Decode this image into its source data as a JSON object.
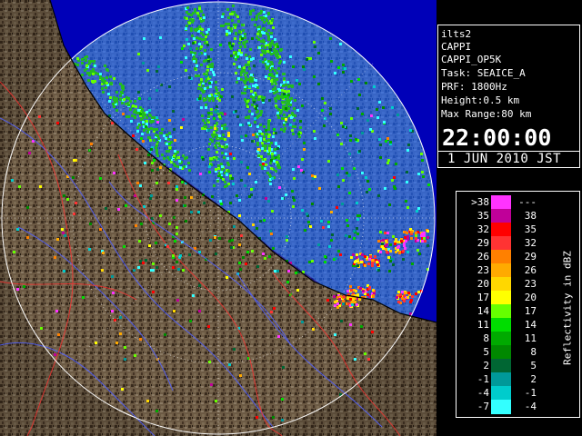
{
  "info": {
    "radar": "ilts2",
    "product": "CAPPI",
    "product_id": "CAPPI_OP5K",
    "task": "Task: SEAICE_A",
    "prf": "PRF: 1800Hz",
    "height": "Height:0.5 km",
    "max_range": "Max Range:80 km",
    "time": "22:00:00",
    "date": "1 JUN 2010 JST"
  },
  "legend": {
    "unit_label": "Reflectivity in dBZ",
    "rows": [
      {
        "low": ">38",
        "high": "---",
        "color": "#ff33ff"
      },
      {
        "low": "35",
        "high": "38",
        "color": "#c00099"
      },
      {
        "low": "32",
        "high": "35",
        "color": "#ff0000"
      },
      {
        "low": "29",
        "high": "32",
        "color": "#ff3333"
      },
      {
        "low": "26",
        "high": "29",
        "color": "#ff8000"
      },
      {
        "low": "23",
        "high": "26",
        "color": "#ffaa00"
      },
      {
        "low": "20",
        "high": "23",
        "color": "#ffd700"
      },
      {
        "low": "17",
        "high": "20",
        "color": "#ffff00"
      },
      {
        "low": "14",
        "high": "17",
        "color": "#66ff00"
      },
      {
        "low": "11",
        "high": "14",
        "color": "#00dd00"
      },
      {
        "low": "8",
        "high": "11",
        "color": "#00aa00"
      },
      {
        "low": "5",
        "high": "8",
        "color": "#008800"
      },
      {
        "low": "2",
        "high": "5",
        "color": "#006633"
      },
      {
        "low": "-1",
        "high": "2",
        "color": "#009999"
      },
      {
        "low": "-4",
        "high": "-1",
        "color": "#00cccc"
      },
      {
        "low": "-7",
        "high": "-4",
        "color": "#33ffff"
      }
    ]
  },
  "colors": {
    "sea": "#0000b8",
    "background": "#000000",
    "coverage_sea": "#0a5cff",
    "land_light": "#9a8468",
    "land_dark": "#3e2e1e",
    "rivers": "#5060ff",
    "roads": "#ff3030",
    "range_rings": "#ffffff"
  }
}
